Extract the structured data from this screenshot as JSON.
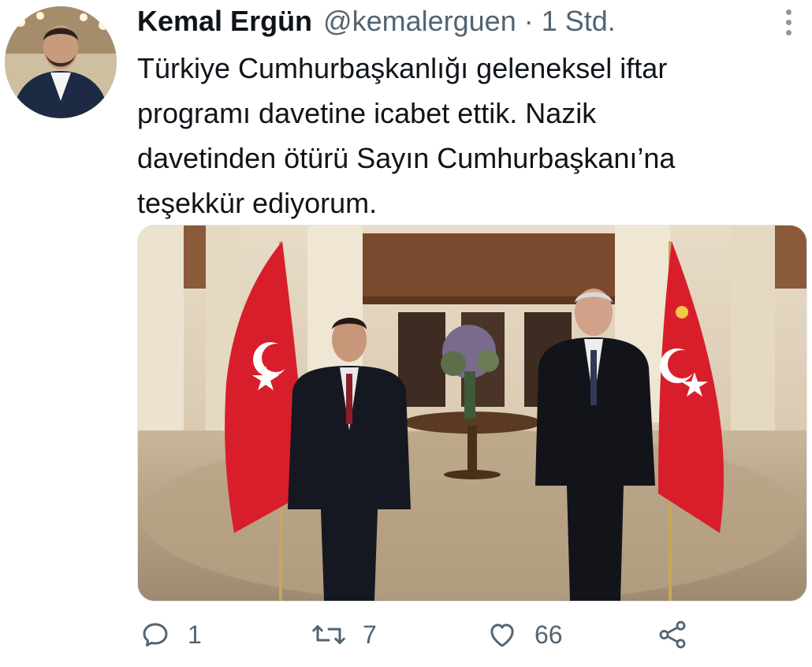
{
  "tweet": {
    "author_name": "Kemal Ergün",
    "handle": "@kemalerguen",
    "separator": "·",
    "time": "1 Std.",
    "text": "Türkiye Cumhurbaşkanlığı geleneksel iftar\nprogramı davetine icabet ettik. Nazik\ndavetinden ötürü Sayın Cumhurbaşkanı’na\nteşekkür ediyorum."
  },
  "actions": {
    "reply_count": "1",
    "retweet_count": "7",
    "like_count": "66"
  },
  "icons": {
    "reply": "reply-icon",
    "retweet": "retweet-icon",
    "like": "heart-icon",
    "share": "share-icon",
    "more": "more-options-icon"
  },
  "colors": {
    "text": "#0f1419",
    "secondary": "#536471",
    "flag_red": "#d91e2b"
  }
}
